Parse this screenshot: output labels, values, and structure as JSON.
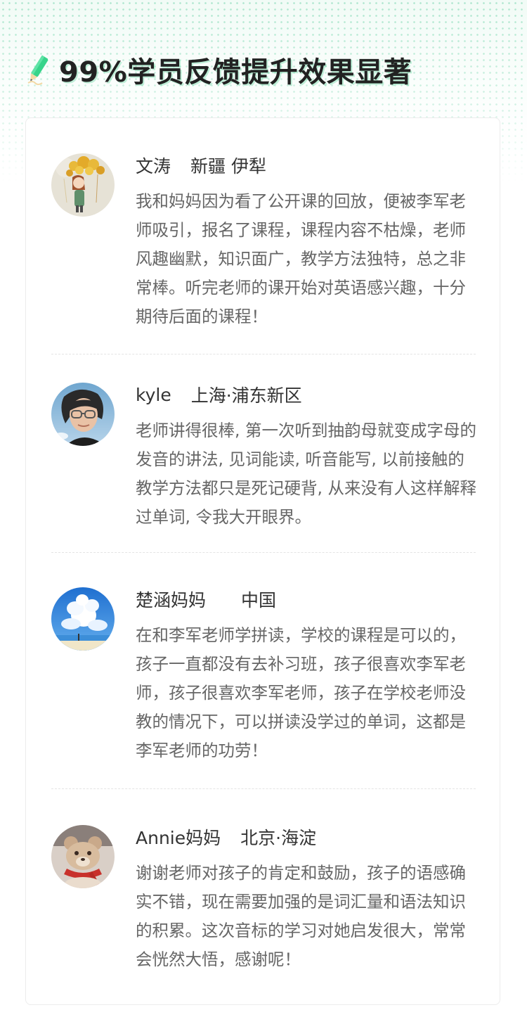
{
  "header": {
    "title": "99%学员反馈提升效果显著",
    "icon": "pencil-icon",
    "accent_color": "#37d48a"
  },
  "reviews": [
    {
      "name": "文涛",
      "location": "新疆 伊犁",
      "avatar": "girl-with-sunflowers-avatar",
      "comment": "我和妈妈因为看了公开课的回放，便被李军老师吸引，报名了课程，课程内容不枯燥，老师风趣幽默，知识面广，教学方法独特，总之非常棒。听完老师的课开始对英语感兴趣，十分期待后面的课程！"
    },
    {
      "name": "kyle",
      "location": "上海·浦东新区",
      "avatar": "person-with-glasses-avatar",
      "comment": "老师讲得很棒, 第一次听到抽韵母就变成字母的发音的讲法, 见词能读, 听音能写, 以前接触的教学方法都只是死记硬背, 从来没有人这样解释过单词, 令我大开眼界。"
    },
    {
      "name": "楚涵妈妈",
      "location": "中国",
      "avatar": "sky-clouds-avatar",
      "comment": "在和李军老师学拼读，学校的课程是可以的，孩子一直都没有去补习班，孩子很喜欢李军老师，孩子很喜欢李军老师，孩子在学校老师没教的情况下，可以拼读没学过的单词，这都是李军老师的功劳！"
    },
    {
      "name": "Annie妈妈",
      "location": "北京·海淀",
      "avatar": "teddy-bear-avatar",
      "comment": "谢谢老师对孩子的肯定和鼓励，孩子的语感确实不错，现在需要加强的是词汇量和语法知识的积累。这次音标的学习对她启发很大，常常会恍然大悟，感谢呢！"
    }
  ]
}
